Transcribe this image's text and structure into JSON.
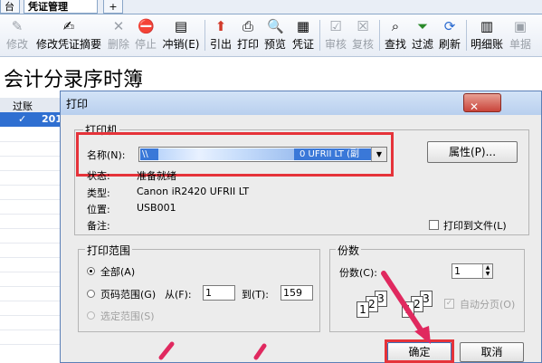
{
  "tabs": [
    "台",
    "凭证管理",
    "+"
  ],
  "toolbar": {
    "items": [
      {
        "label": "修改",
        "icon": "edit-icon",
        "enabled": false
      },
      {
        "label": "修改凭证摘要",
        "icon": "edit-summary-icon",
        "enabled": true
      },
      {
        "label": "删除",
        "icon": "delete-icon",
        "enabled": false
      },
      {
        "label": "停止",
        "icon": "stop-icon",
        "enabled": false
      },
      {
        "label": "冲销(E)",
        "icon": "reverse-icon",
        "enabled": true
      },
      {
        "label": "引出",
        "icon": "export-icon",
        "enabled": true
      },
      {
        "label": "打印",
        "icon": "print-icon",
        "enabled": true
      },
      {
        "label": "预览",
        "icon": "preview-icon",
        "enabled": true
      },
      {
        "label": "凭证",
        "icon": "voucher-icon",
        "enabled": true
      },
      {
        "label": "审核",
        "icon": "audit-icon",
        "enabled": false
      },
      {
        "label": "复核",
        "icon": "recheck-icon",
        "enabled": false
      },
      {
        "label": "查找",
        "icon": "find-icon",
        "enabled": true
      },
      {
        "label": "过滤",
        "icon": "filter-icon",
        "enabled": true
      },
      {
        "label": "刷新",
        "icon": "refresh-icon",
        "enabled": true
      },
      {
        "label": "明细账",
        "icon": "ledger-icon",
        "enabled": true
      },
      {
        "label": "单据",
        "icon": "document-icon",
        "enabled": false
      }
    ]
  },
  "page_title": "会计分录序时簿",
  "grid": {
    "header": "过账",
    "row_mark": "✓",
    "row_text": "201"
  },
  "dialog": {
    "title": "打印",
    "close_symbol": "✕",
    "printer_group": "打印机",
    "name_label": "名称(N):",
    "name_value": "\\\\",
    "name_value_suffix": "0 UFRII LT (副",
    "properties_button": "属性(P)...",
    "status_label": "状态:",
    "status_value": "准备就绪",
    "type_label": "类型:",
    "type_value": "Canon iR2420 UFRII LT",
    "location_label": "位置:",
    "location_value": "USB001",
    "comment_label": "备注:",
    "print_to_file_label": "打印到文件(L)",
    "range_group": "打印范围",
    "range_all": "全部(A)",
    "range_pages": "页码范围(G)",
    "range_from": "从(F):",
    "range_from_value": "1",
    "range_to": "到(T):",
    "range_to_value": "159",
    "range_selection": "选定范围(S)",
    "copies_group": "份数",
    "copies_label": "份数(C):",
    "copies_value": "1",
    "collate_label": "自动分页(O)",
    "ok_button": "确定",
    "cancel_button": "取消"
  },
  "colors": {
    "highlight": "#e5333a",
    "selection": "#3a78d8",
    "arrow": "#e0295f"
  }
}
